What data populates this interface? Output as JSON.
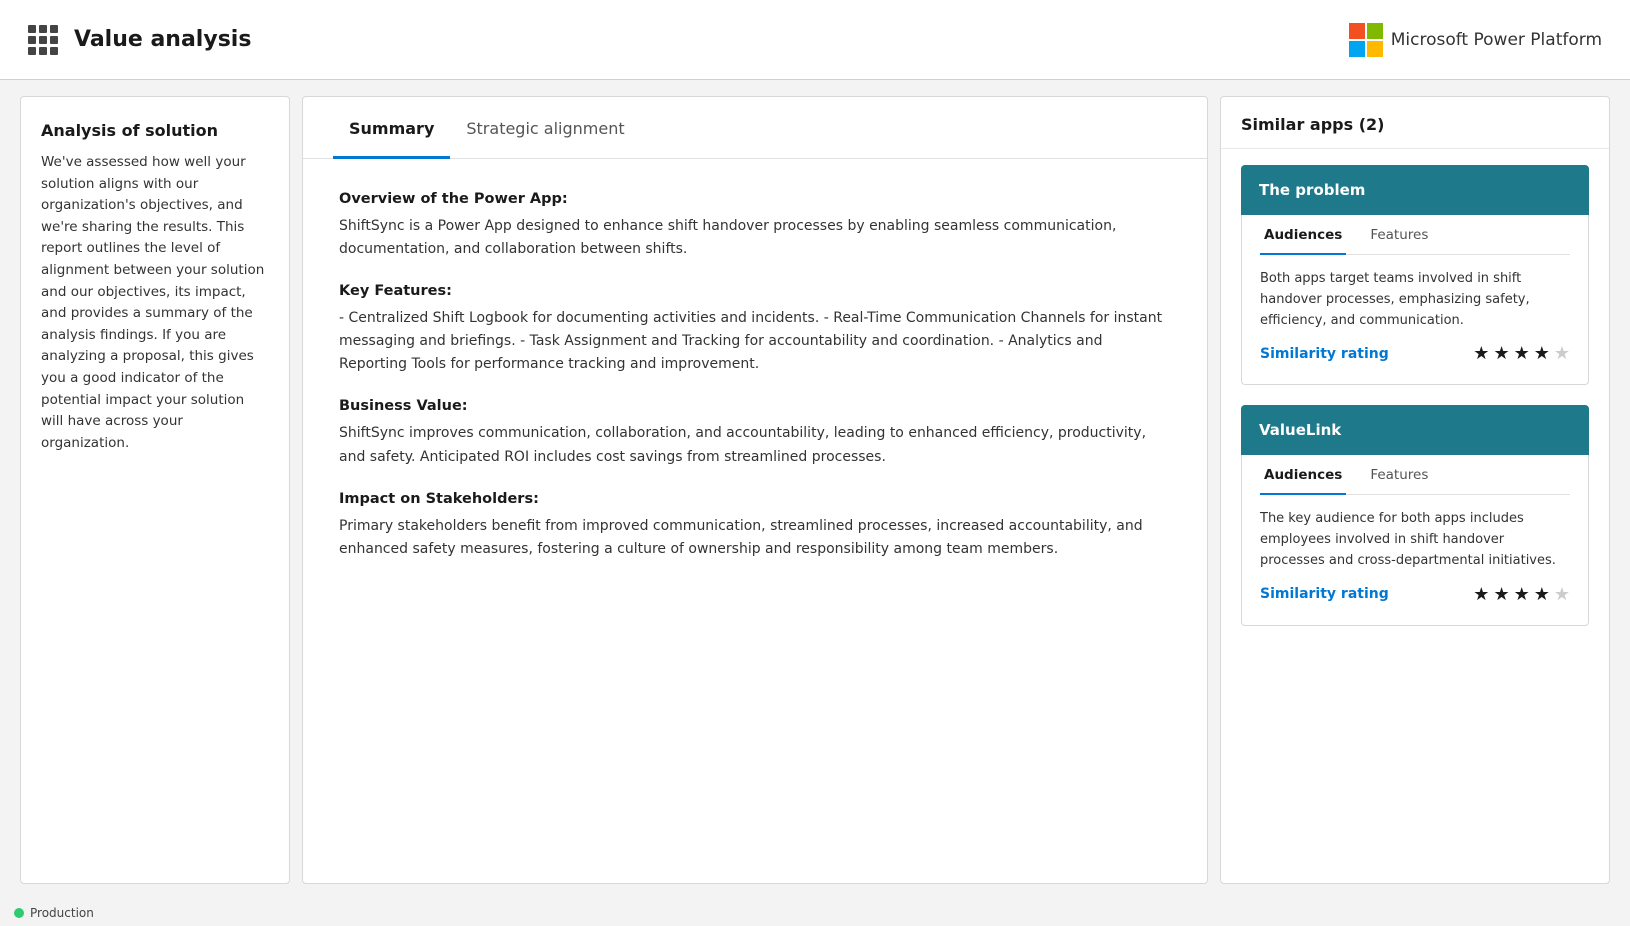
{
  "header": {
    "title": "Value analysis",
    "brand": "Microsoft Power Platform"
  },
  "leftPanel": {
    "title": "Analysis of solution",
    "body": "We've assessed how well your solution aligns with our organization's objectives, and we're sharing the results. This report outlines the level of alignment between your solution and our objectives, its impact, and provides a summary of the analysis findings. If you are analyzing a proposal, this gives you a good indicator of the potential impact your solution will have across your organization."
  },
  "centerPanel": {
    "tabs": [
      {
        "label": "Summary",
        "active": true
      },
      {
        "label": "Strategic alignment",
        "active": false
      }
    ],
    "sections": [
      {
        "heading": "Overview of the Power App:",
        "text": "ShiftSync is a Power App designed to enhance shift handover processes by enabling seamless communication, documentation, and collaboration between shifts."
      },
      {
        "heading": "Key Features:",
        "text": "- Centralized Shift Logbook for documenting activities and incidents. - Real-Time Communication Channels for instant messaging and briefings. - Task Assignment and Tracking for accountability and coordination. - Analytics and Reporting Tools for performance tracking and improvement."
      },
      {
        "heading": "Business Value:",
        "text": "ShiftSync improves communication, collaboration, and accountability, leading to enhanced efficiency, productivity, and safety. Anticipated ROI includes cost savings from streamlined processes."
      },
      {
        "heading": "Impact on Stakeholders:",
        "text": "Primary stakeholders benefit from improved communication, streamlined processes, increased accountability, and enhanced safety measures, fostering a culture of ownership and responsibility among team members."
      }
    ]
  },
  "rightPanel": {
    "title": "Similar apps (2)",
    "apps": [
      {
        "name": "The problem",
        "tabs": [
          "Audiences",
          "Features"
        ],
        "activeTab": "Audiences",
        "audienceText": "Both apps target teams involved in shift handover processes, emphasizing safety, efficiency, and communication.",
        "similarityLabel": "Similarity rating",
        "stars": 4
      },
      {
        "name": "ValueLink",
        "tabs": [
          "Audiences",
          "Features"
        ],
        "activeTab": "Audiences",
        "audienceText": "The key audience for both apps includes employees involved in shift handover processes and cross-departmental initiatives.",
        "similarityLabel": "Similarity rating",
        "stars": 4
      }
    ]
  },
  "statusBar": {
    "environment": "Production"
  }
}
